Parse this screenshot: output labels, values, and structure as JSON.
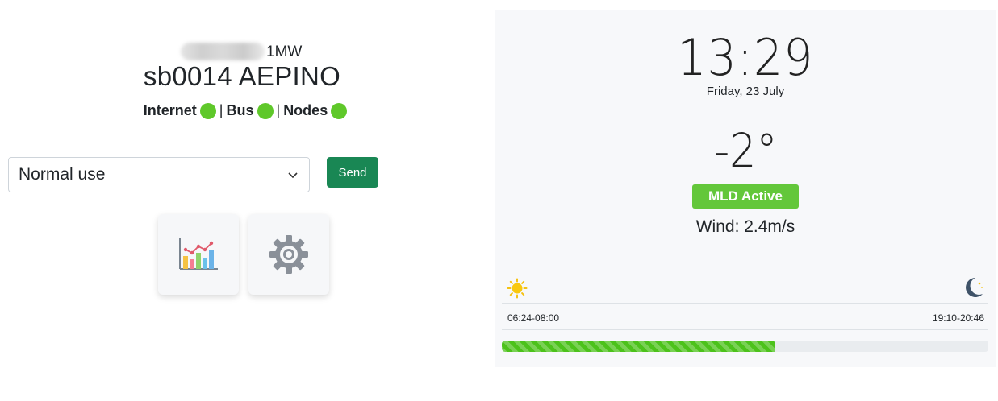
{
  "device": {
    "subtitle_code": "1MW",
    "title": "sb0014 AEPINO"
  },
  "status": {
    "items": [
      {
        "label": "Internet",
        "color": "#5fc82a"
      },
      {
        "label": "Bus",
        "color": "#5fc82a"
      },
      {
        "label": "Nodes",
        "color": "#5fc82a"
      }
    ],
    "separator": "|"
  },
  "mode": {
    "selected": "Normal use",
    "send_label": "Send",
    "send_color": "#198754"
  },
  "shortcuts": [
    {
      "icon": "bar-chart-icon"
    },
    {
      "icon": "gear-icon"
    }
  ],
  "display": {
    "time": "13:29",
    "date": "Friday, 23 July",
    "temperature": "-2°",
    "badge": "MLD Active",
    "badge_color": "#63c73a",
    "wind": "Wind: 2.4m/s",
    "sunrise_window": "06:24-08:00",
    "sunset_window": "19:10-20:46",
    "day_progress_percent": 56,
    "day_icon": "sun-icon",
    "night_icon": "moon-icon"
  }
}
